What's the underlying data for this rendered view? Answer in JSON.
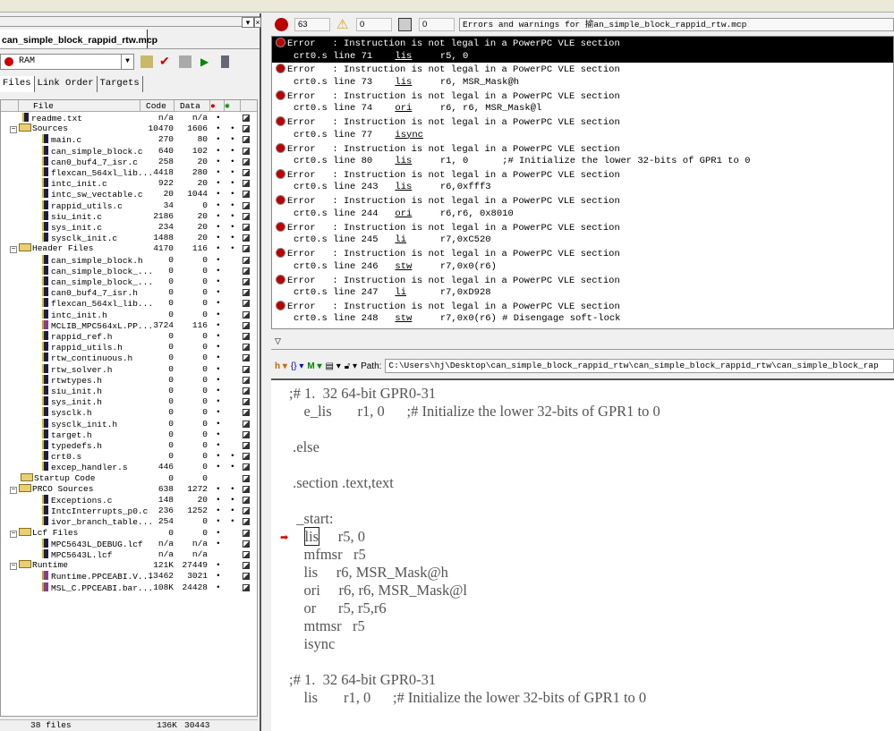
{
  "project": {
    "tab": "can_simple_block_rappid_rtw.mcp",
    "target": "RAM",
    "subtabs": [
      "Files",
      "Link Order",
      "Targets"
    ],
    "columns": [
      "File",
      "Code",
      "Data"
    ],
    "rows": [
      {
        "n": "readme.txt",
        "c": "n/a",
        "d": "n/a",
        "l": 0,
        "t": "f",
        "a": 1,
        "b": 0
      },
      {
        "n": "Sources",
        "c": "10470",
        "d": "1606",
        "l": 0,
        "t": "g",
        "a": 1,
        "b": 1
      },
      {
        "n": "main.c",
        "c": "270",
        "d": "80",
        "l": 1,
        "t": "f",
        "a": 1,
        "b": 1
      },
      {
        "n": "can_simple_block.c",
        "c": "640",
        "d": "102",
        "l": 1,
        "t": "f",
        "a": 1,
        "b": 1
      },
      {
        "n": "can0_buf4_7_isr.c",
        "c": "258",
        "d": "20",
        "l": 1,
        "t": "f",
        "a": 1,
        "b": 1
      },
      {
        "n": "flexcan_564xl_lib...",
        "c": "4418",
        "d": "280",
        "l": 1,
        "t": "f",
        "a": 1,
        "b": 1
      },
      {
        "n": "intc_init.c",
        "c": "922",
        "d": "20",
        "l": 1,
        "t": "f",
        "a": 1,
        "b": 1
      },
      {
        "n": "intc_sw_vectable.c",
        "c": "20",
        "d": "1044",
        "l": 1,
        "t": "f",
        "a": 1,
        "b": 1
      },
      {
        "n": "rappid_utils.c",
        "c": "34",
        "d": "0",
        "l": 1,
        "t": "f",
        "a": 1,
        "b": 1
      },
      {
        "n": "siu_init.c",
        "c": "2186",
        "d": "20",
        "l": 1,
        "t": "f",
        "a": 1,
        "b": 1
      },
      {
        "n": "sys_init.c",
        "c": "234",
        "d": "20",
        "l": 1,
        "t": "f",
        "a": 1,
        "b": 1
      },
      {
        "n": "sysclk_init.c",
        "c": "1488",
        "d": "20",
        "l": 1,
        "t": "f",
        "a": 1,
        "b": 1
      },
      {
        "n": "Header Files",
        "c": "4170",
        "d": "116",
        "l": 0,
        "t": "g",
        "a": 1,
        "b": 1
      },
      {
        "n": "can_simple_block.h",
        "c": "0",
        "d": "0",
        "l": 1,
        "t": "f",
        "a": 1,
        "b": 0
      },
      {
        "n": "can_simple_block_...",
        "c": "0",
        "d": "0",
        "l": 1,
        "t": "f",
        "a": 1,
        "b": 0
      },
      {
        "n": "can_simple_block_...",
        "c": "0",
        "d": "0",
        "l": 1,
        "t": "f",
        "a": 1,
        "b": 0
      },
      {
        "n": "can0_buf4_7_isr.h",
        "c": "0",
        "d": "0",
        "l": 1,
        "t": "f",
        "a": 1,
        "b": 0
      },
      {
        "n": "flexcan_564xl_lib...",
        "c": "0",
        "d": "0",
        "l": 1,
        "t": "f",
        "a": 1,
        "b": 0
      },
      {
        "n": "intc_init.h",
        "c": "0",
        "d": "0",
        "l": 1,
        "t": "f",
        "a": 1,
        "b": 0
      },
      {
        "n": "MCLIB_MPC564xL.PP...",
        "c": "3724",
        "d": "116",
        "l": 1,
        "t": "lib",
        "a": 1,
        "b": 0
      },
      {
        "n": "rappid_ref.h",
        "c": "0",
        "d": "0",
        "l": 1,
        "t": "f",
        "a": 1,
        "b": 0
      },
      {
        "n": "rappid_utils.h",
        "c": "0",
        "d": "0",
        "l": 1,
        "t": "f",
        "a": 1,
        "b": 0
      },
      {
        "n": "rtw_continuous.h",
        "c": "0",
        "d": "0",
        "l": 1,
        "t": "f",
        "a": 1,
        "b": 0
      },
      {
        "n": "rtw_solver.h",
        "c": "0",
        "d": "0",
        "l": 1,
        "t": "f",
        "a": 1,
        "b": 0
      },
      {
        "n": "rtwtypes.h",
        "c": "0",
        "d": "0",
        "l": 1,
        "t": "f",
        "a": 1,
        "b": 0
      },
      {
        "n": "siu_init.h",
        "c": "0",
        "d": "0",
        "l": 1,
        "t": "f",
        "a": 1,
        "b": 0
      },
      {
        "n": "sys_init.h",
        "c": "0",
        "d": "0",
        "l": 1,
        "t": "f",
        "a": 1,
        "b": 0
      },
      {
        "n": "sysclk.h",
        "c": "0",
        "d": "0",
        "l": 1,
        "t": "f",
        "a": 1,
        "b": 0
      },
      {
        "n": "sysclk_init.h",
        "c": "0",
        "d": "0",
        "l": 1,
        "t": "f",
        "a": 1,
        "b": 0
      },
      {
        "n": "target.h",
        "c": "0",
        "d": "0",
        "l": 1,
        "t": "f",
        "a": 1,
        "b": 0
      },
      {
        "n": "typedefs.h",
        "c": "0",
        "d": "0",
        "l": 1,
        "t": "f",
        "a": 1,
        "b": 0
      },
      {
        "n": "crt0.s",
        "c": "0",
        "d": "0",
        "l": 1,
        "t": "f",
        "a": 1,
        "b": 1
      },
      {
        "n": "excep_handler.s",
        "c": "446",
        "d": "0",
        "l": 1,
        "t": "f",
        "a": 1,
        "b": 1
      },
      {
        "n": "Startup Code",
        "c": "0",
        "d": "0",
        "l": 0,
        "t": "g0",
        "a": 0,
        "b": 0
      },
      {
        "n": "PRCO Sources",
        "c": "638",
        "d": "1272",
        "l": 0,
        "t": "g",
        "a": 1,
        "b": 1
      },
      {
        "n": "Exceptions.c",
        "c": "148",
        "d": "20",
        "l": 1,
        "t": "f",
        "a": 1,
        "b": 1
      },
      {
        "n": "IntcInterrupts_p0.c",
        "c": "236",
        "d": "1252",
        "l": 1,
        "t": "f",
        "a": 1,
        "b": 1
      },
      {
        "n": "ivor_branch_table...",
        "c": "254",
        "d": "0",
        "l": 1,
        "t": "f",
        "a": 1,
        "b": 1
      },
      {
        "n": "Lcf Files",
        "c": "0",
        "d": "0",
        "l": 0,
        "t": "g",
        "a": 1,
        "b": 0
      },
      {
        "n": "MPC5643L_DEBUG.lcf",
        "c": "n/a",
        "d": "n/a",
        "l": 1,
        "t": "f",
        "a": 1,
        "b": 0
      },
      {
        "n": "MPC5643L.lcf",
        "c": "n/a",
        "d": "n/a",
        "l": 1,
        "t": "f",
        "a": 0,
        "b": 0
      },
      {
        "n": "Runtime",
        "c": "121K",
        "d": "27449",
        "l": 0,
        "t": "g",
        "a": 1,
        "b": 0
      },
      {
        "n": "Runtime.PPCEABI.V...",
        "c": "13462",
        "d": "3021",
        "l": 1,
        "t": "lib",
        "a": 1,
        "b": 0
      },
      {
        "n": "MSL_C.PPCEABI.bar...",
        "c": "108K",
        "d": "24428",
        "l": 1,
        "t": "lib",
        "a": 1,
        "b": 0
      }
    ],
    "footer": {
      "files": "38 files",
      "code": "136K",
      "data": "30443"
    }
  },
  "messages": {
    "errors": "63",
    "warnings": "0",
    "infos": "0",
    "title": "Errors and warnings for 揄an_simple_block_rappid_rtw.mcp",
    "items": [
      {
        "msg": "Error   : Instruction is not legal in a PowerPC VLE section",
        "loc": "crt0.s line 71    ",
        "ins": "lis",
        "rest": "     r5, 0"
      },
      {
        "msg": "Error   : Instruction is not legal in a PowerPC VLE section",
        "loc": "crt0.s line 73    ",
        "ins": "lis",
        "rest": "     r6, MSR_Mask@h"
      },
      {
        "msg": "Error   : Instruction is not legal in a PowerPC VLE section",
        "loc": "crt0.s line 74    ",
        "ins": "ori",
        "rest": "     r6, r6, MSR_Mask@l"
      },
      {
        "msg": "Error   : Instruction is not legal in a PowerPC VLE section",
        "loc": "crt0.s line 77    ",
        "ins": "isync",
        "rest": ""
      },
      {
        "msg": "Error   : Instruction is not legal in a PowerPC VLE section",
        "loc": "crt0.s line 80    ",
        "ins": "lis",
        "rest": "     r1, 0      ;# Initialize the lower 32-bits of GPR1 to 0"
      },
      {
        "msg": "Error   : Instruction is not legal in a PowerPC VLE section",
        "loc": "crt0.s line 243   ",
        "ins": "lis",
        "rest": "     r6,0xfff3"
      },
      {
        "msg": "Error   : Instruction is not legal in a PowerPC VLE section",
        "loc": "crt0.s line 244   ",
        "ins": "ori",
        "rest": "     r6,r6, 0x8010"
      },
      {
        "msg": "Error   : Instruction is not legal in a PowerPC VLE section",
        "loc": "crt0.s line 245   ",
        "ins": "li",
        "rest": "      r7,0xC520"
      },
      {
        "msg": "Error   : Instruction is not legal in a PowerPC VLE section",
        "loc": "crt0.s line 246   ",
        "ins": "stw",
        "rest": "     r7,0x0(r6)"
      },
      {
        "msg": "Error   : Instruction is not legal in a PowerPC VLE section",
        "loc": "crt0.s line 247   ",
        "ins": "li",
        "rest": "      r7,0xD928"
      },
      {
        "msg": "Error   : Instruction is not legal in a PowerPC VLE section",
        "loc": "crt0.s line 248   ",
        "ins": "stw",
        "rest": "     r7,0x0(r6) # Disengage soft-lock"
      }
    ]
  },
  "editor": {
    "path_label": "Path:",
    "path": "C:\\Users\\hj\\Desktop\\can_simple_block_rappid_rtw\\can_simple_block_rappid_rtw\\can_simple_block_rap",
    "lines": [
      {
        "y": 0,
        "t": ";# 1.  32 64-bit GPR0-31"
      },
      {
        "y": 1,
        "t": "    e_lis       r1, 0      ;# Initialize the lower 32-bits of GPR1 to 0"
      },
      {
        "y": 3,
        "t": " .else"
      },
      {
        "y": 5,
        "t": " .section .text,text"
      },
      {
        "y": 7,
        "t": "  _start:"
      },
      {
        "y": 9,
        "t": "    mfmsr   r5"
      },
      {
        "y": 10,
        "t": "    lis     r6, MSR_Mask@h"
      },
      {
        "y": 11,
        "t": "    ori     r6, r6, MSR_Mask@l"
      },
      {
        "y": 12,
        "t": "    or      r5, r5,r6"
      },
      {
        "y": 13,
        "t": "    mtmsr   r5"
      },
      {
        "y": 14,
        "t": "    isync"
      },
      {
        "y": 16,
        "t": ";# 1.  32 64-bit GPR0-31"
      },
      {
        "y": 17,
        "t": "    lis       r1, 0      ;# Initialize the lower 32-bits of GPR1 to 0"
      }
    ],
    "cursor_line": {
      "ins": "lis",
      "rest": "     r5, 0"
    }
  },
  "colors": {
    "error": "#bb0000",
    "selection": "#000000",
    "code": "#555555"
  }
}
